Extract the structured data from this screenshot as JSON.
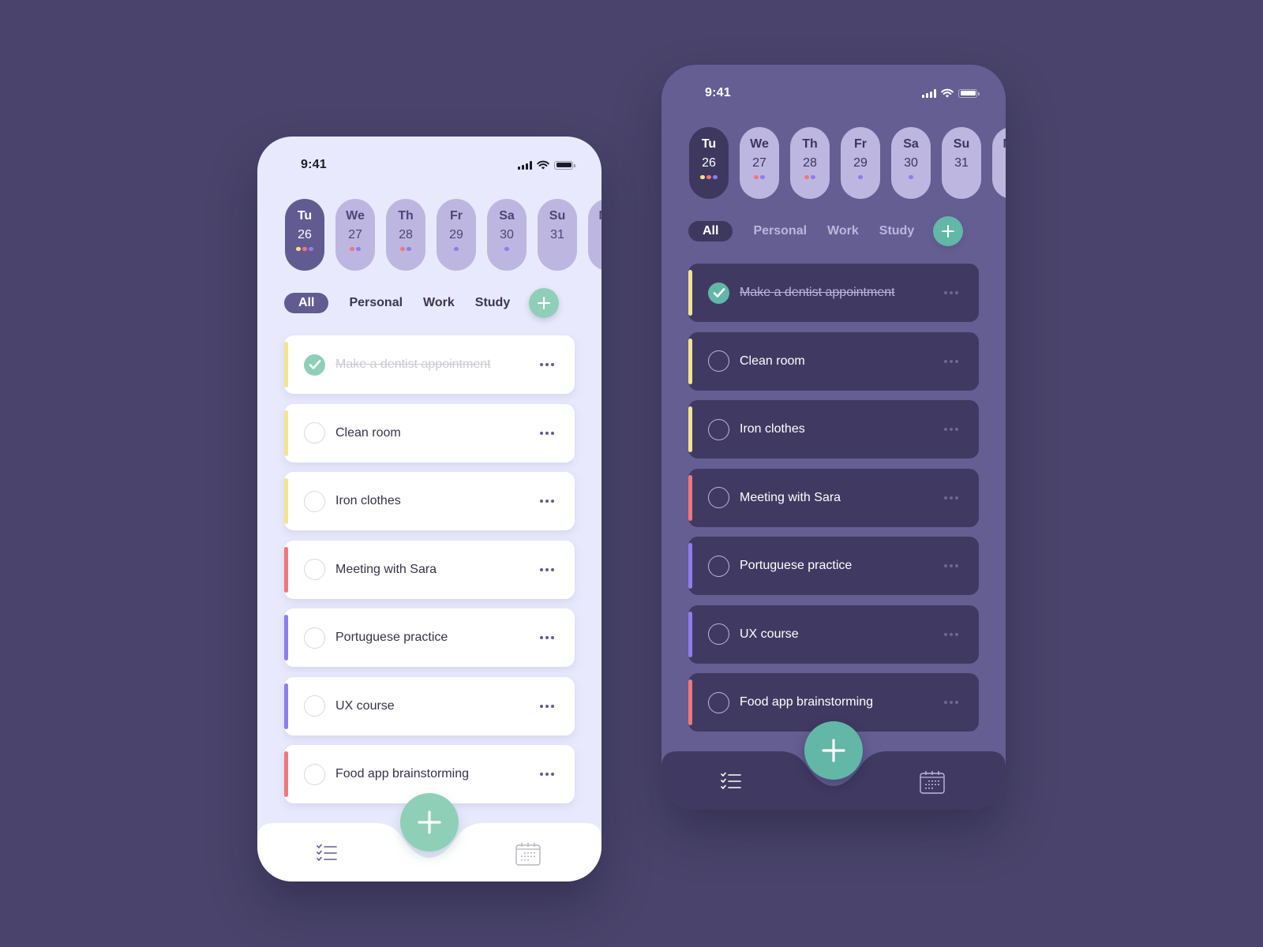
{
  "status_bar": {
    "time": "9:41"
  },
  "days": [
    {
      "name": "Tu",
      "number": "26",
      "active": true,
      "dots": [
        "#f1e48f",
        "#f07878",
        "#8e7cf0"
      ]
    },
    {
      "name": "We",
      "number": "27",
      "active": false,
      "dots": [
        "#f07878",
        "#8e7cf0"
      ]
    },
    {
      "name": "Th",
      "number": "28",
      "active": false,
      "dots": [
        "#f07878",
        "#8e7cf0"
      ]
    },
    {
      "name": "Fr",
      "number": "29",
      "active": false,
      "dots": [
        "#8e7cf0"
      ]
    },
    {
      "name": "Sa",
      "number": "30",
      "active": false,
      "dots": [
        "#8e7cf0"
      ]
    },
    {
      "name": "Su",
      "number": "31",
      "active": false,
      "dots": []
    },
    {
      "name": "Mo",
      "number": "",
      "active": false,
      "dots": []
    }
  ],
  "filters": [
    {
      "label": "All",
      "active": true
    },
    {
      "label": "Personal",
      "active": false
    },
    {
      "label": "Work",
      "active": false
    },
    {
      "label": "Study",
      "active": false
    }
  ],
  "category_colors": {
    "personal": "#f1e48f",
    "work": "#f07878",
    "study": "#8e7cf0"
  },
  "tasks": [
    {
      "title": "Make a dentist appointment",
      "done": true,
      "category": "personal"
    },
    {
      "title": "Clean room",
      "done": false,
      "category": "personal"
    },
    {
      "title": "Iron clothes",
      "done": false,
      "category": "personal"
    },
    {
      "title": "Meeting with Sara",
      "done": false,
      "category": "work"
    },
    {
      "title": "Portuguese practice",
      "done": false,
      "category": "study"
    },
    {
      "title": "UX course",
      "done": false,
      "category": "study"
    },
    {
      "title": "Food app brainstorming",
      "done": false,
      "category": "work"
    }
  ],
  "tabbar": {
    "tabs": [
      "tasks-list",
      "calendar"
    ]
  },
  "themes": {
    "light": {
      "accent": "#8fcfb8",
      "primary": "#625b91",
      "background": "#e8e9fc"
    },
    "dark": {
      "accent": "#62b7a7",
      "primary": "#3e385f",
      "background": "#645e93"
    }
  }
}
